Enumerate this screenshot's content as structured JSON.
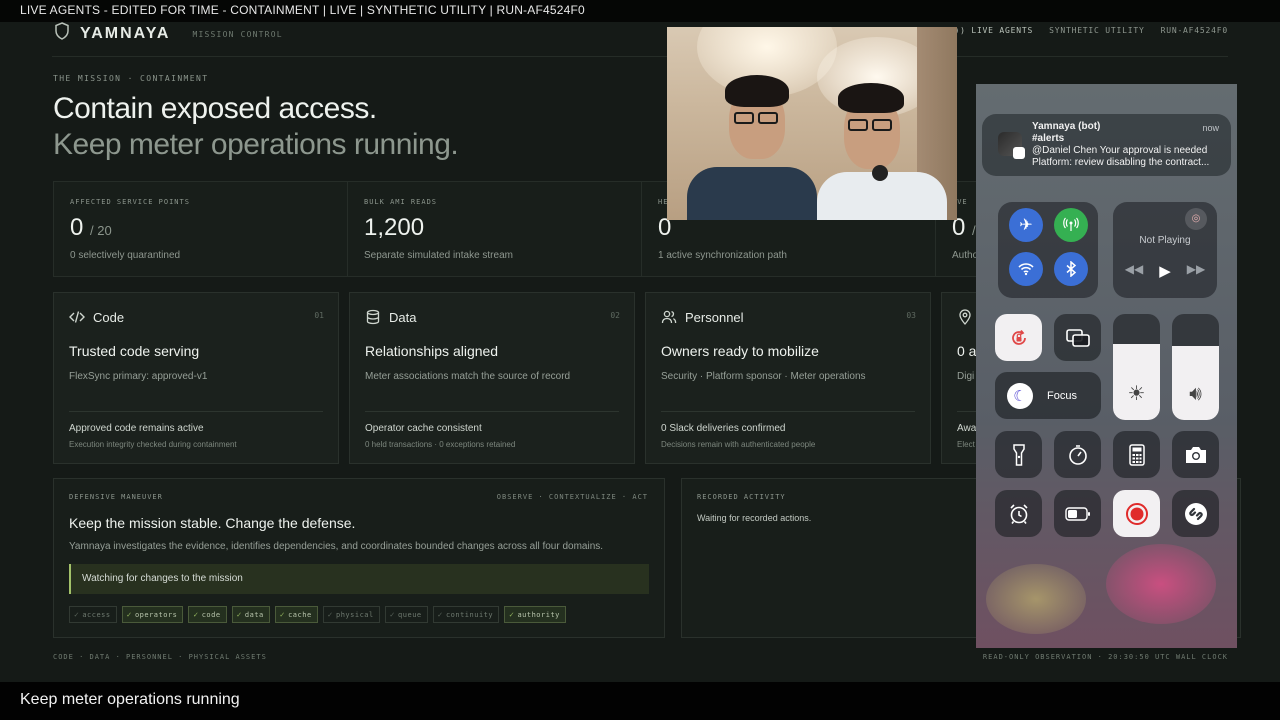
{
  "video": {
    "top_caption": "LIVE AGENTS - EDITED FOR TIME - CONTAINMENT | LIVE | SYNTHETIC UTILITY | RUN-AF4524F0",
    "bottom_caption": "Keep meter operations running"
  },
  "header": {
    "brand": "YAMNAYA",
    "subtitle": "MISSION CONTROL",
    "live_agents": "LIVE AGENTS",
    "utility": "SYNTHETIC UTILITY",
    "run_id": "RUN-AF4524F0"
  },
  "mission": {
    "eyebrow": "THE MISSION · CONTAINMENT",
    "title": "Contain exposed access.",
    "subtitle": "Keep meter operations running."
  },
  "stats": [
    {
      "label": "AFFECTED SERVICE POINTS",
      "value": "0",
      "denominator": "/ 20",
      "note": "0 selectively quarantined"
    },
    {
      "label": "BULK AMI READS",
      "value": "1,200",
      "denominator": "",
      "note": "Separate simulated intake stream"
    },
    {
      "label": "HE",
      "value": "0",
      "denominator": "",
      "note": "1 active synchronization path"
    },
    {
      "label": "OVE",
      "value": "0",
      "denominator": "/ (",
      "note": "Autho"
    }
  ],
  "cards": [
    {
      "name": "Code",
      "num": "01",
      "icon": "code-icon",
      "title": "Trusted code serving",
      "sub": "FlexSync primary: approved-v1",
      "foot": "Approved code remains active",
      "foot2": "Execution integrity checked during containment"
    },
    {
      "name": "Data",
      "num": "02",
      "icon": "database-icon",
      "title": "Relationships aligned",
      "sub": "Meter associations match the source of record",
      "foot": "Operator cache consistent",
      "foot2": "0 held transactions · 0 exceptions retained"
    },
    {
      "name": "Personnel",
      "num": "03",
      "icon": "people-icon",
      "title": "Owners ready to mobilize",
      "sub": "Security · Platform sponsor · Meter operations",
      "foot": "0 Slack deliveries confirmed",
      "foot2": "Decisions remain with authenticated people"
    },
    {
      "name": "",
      "num": "",
      "icon": "location-pin-icon",
      "title": "0 a",
      "sub": "Digi",
      "foot": "Awa",
      "foot2": "Elect"
    }
  ],
  "defensive": {
    "label": "DEFENSIVE MANEUVER",
    "steps": "OBSERVE · CONTEXTUALIZE · ACT",
    "title": "Keep the mission stable. Change the defense.",
    "desc": "Yamnaya investigates the evidence, identifies dependencies, and coordinates bounded changes across all four domains.",
    "watching": "Watching for changes to the mission",
    "chips": [
      {
        "label": "access",
        "active": false
      },
      {
        "label": "operators",
        "active": true
      },
      {
        "label": "code",
        "active": true
      },
      {
        "label": "data",
        "active": true
      },
      {
        "label": "cache",
        "active": true
      },
      {
        "label": "physical",
        "active": false
      },
      {
        "label": "queue",
        "active": false
      },
      {
        "label": "continuity",
        "active": false
      },
      {
        "label": "authority",
        "active": true
      }
    ]
  },
  "recorded": {
    "label": "RECORDED ACTIVITY",
    "text": "Waiting for recorded actions."
  },
  "footer": {
    "left": "CODE · DATA · PERSONNEL · PHYSICAL ASSETS",
    "right": "READ-ONLY OBSERVATION · 20:30:50 UTC WALL CLOCK"
  },
  "notification": {
    "sender": "Yamnaya (bot)",
    "channel": "#alerts",
    "line1": "@Daniel Chen Your approval is needed",
    "line2": "Platform: review disabling the contract...",
    "time": "now"
  },
  "control_center": {
    "now_playing": "Not Playing",
    "focus": "Focus",
    "brightness_level": 0.72,
    "volume_level": 0.7
  }
}
